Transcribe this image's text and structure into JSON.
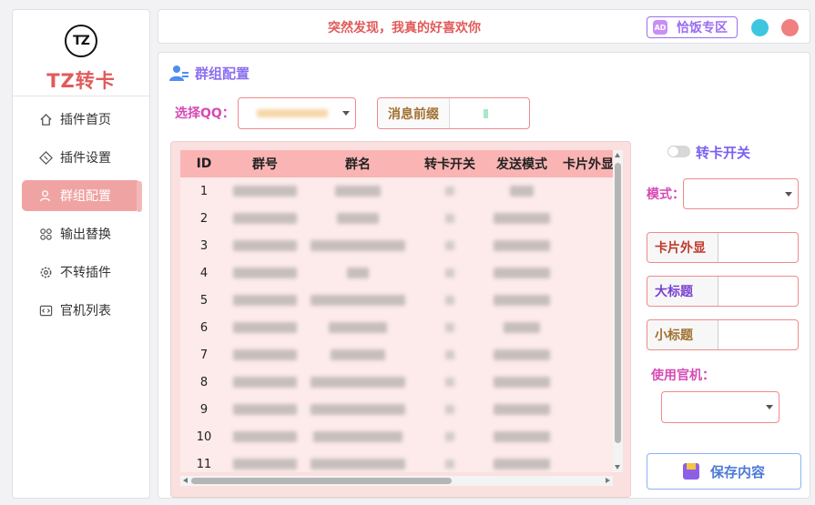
{
  "brand": {
    "logo_text": "TZ",
    "title": "TZ转卡"
  },
  "nav": [
    {
      "label": "插件首页",
      "icon": "home-icon"
    },
    {
      "label": "插件设置",
      "icon": "settings-icon"
    },
    {
      "label": "群组配置",
      "icon": "user-group-icon",
      "active": true
    },
    {
      "label": "输出替换",
      "icon": "grid-icon"
    },
    {
      "label": "不转插件",
      "icon": "gear-icon"
    },
    {
      "label": "官机列表",
      "icon": "code-icon"
    }
  ],
  "banner": {
    "message": "突然发现，我真的好喜欢你",
    "rice_label": "恰饭专区"
  },
  "section": {
    "title": "群组配置"
  },
  "qq": {
    "label": "选择QQ："
  },
  "prefix": {
    "label": "消息前缀"
  },
  "table": {
    "columns": [
      "ID",
      "群号",
      "群名",
      "转卡开关",
      "发送模式",
      "卡片外显"
    ],
    "rows": [
      "1",
      "2",
      "3",
      "4",
      "5",
      "6",
      "7",
      "8",
      "9",
      "10",
      "11"
    ]
  },
  "right": {
    "toggle_label": "转卡开关",
    "toggle_on": false,
    "mode_label": "模式：",
    "card_label": "卡片外显",
    "big_title_label": "大标题",
    "small_title_label": "小标题",
    "official_label": "使用官机：",
    "save_label": "保存内容"
  },
  "colors": {
    "accent_red": "#e25a5a",
    "accent_purple": "#8b6ff0",
    "nav_active": "#f0a3a3",
    "table_header": "#fbb4b4",
    "border_red": "#f08a8a"
  }
}
